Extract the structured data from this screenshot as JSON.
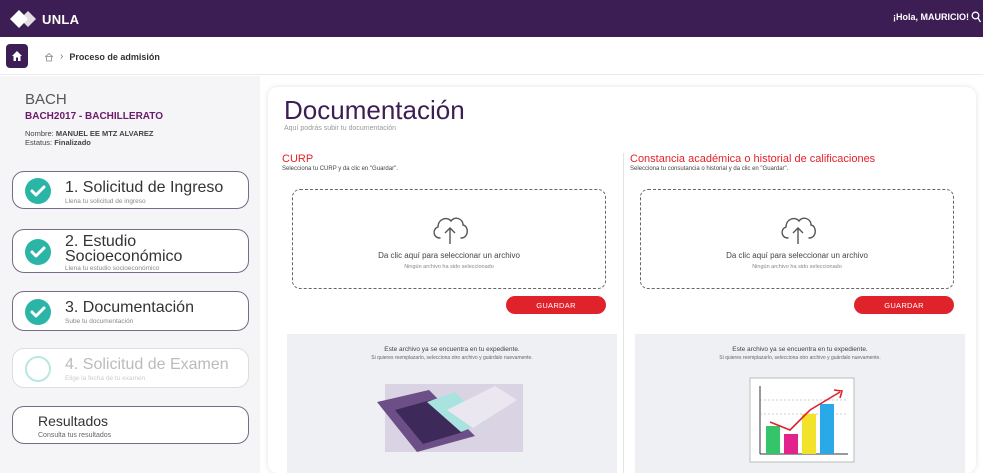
{
  "app": {
    "name": "UNLA",
    "greeting": "¡Hola, MAURICIO!"
  },
  "breadcrumb": {
    "current": "Proceso de admisión"
  },
  "program": {
    "code": "BACH",
    "name": "BACH2017 - BACHILLERATO",
    "student_label": "Nombre:",
    "student_name": "MANUEL EE MTZ ALVAREZ",
    "status_label": "Estatus:",
    "status_value": "Finalizado"
  },
  "steps": [
    {
      "title": "1. Solicitud de Ingreso",
      "sub": "Llena tu solicitud de ingreso",
      "state": "done"
    },
    {
      "title_line1": "2. Estudio",
      "title_line2": "Socioeconómico",
      "sub": "Llena tu estudio socioeconómico",
      "state": "done"
    },
    {
      "title": "3. Documentación",
      "sub": "Sube tu documentación",
      "state": "done"
    },
    {
      "title": "4. Solicitud de Examen",
      "sub": "Elige la fecha de tu examen",
      "state": "pending"
    }
  ],
  "results": {
    "title": "Resultados",
    "sub": "Consulta tus resultados"
  },
  "main": {
    "title": "Documentación",
    "subtitle": "Aquí podrás subir tu documentación",
    "documents": [
      {
        "title": "CURP",
        "instructions": "Selecciona tu CURP y da clic en \"Guardar\".",
        "dropzone_main": "Da clic aquí para seleccionar un archivo",
        "dropzone_sub": "Ningún archivo ha sido seleccionado",
        "save_label": "GUARDAR",
        "file_status": "Este archivo ya se encuentra en tu expediente.",
        "file_hint": "Si quieres reemplazarlo, selecciona otro archivo y guárdalo nuevamente."
      },
      {
        "title": "Constancia académica o historial de calificaciones",
        "instructions": "Selecciona tu consutancia o historial y da clic en \"Guardar\".",
        "dropzone_main": "Da clic aquí para seleccionar un archivo",
        "dropzone_sub": "Ningún archivo ha sido seleccionado",
        "save_label": "GUARDAR",
        "file_status": "Este archivo ya se encuentra en tu expediente.",
        "file_hint": "Si quieres reemplazarlo, selecciona otro archivo y guárdalo nuevamente."
      }
    ]
  },
  "colors": {
    "brand": "#3d1e54",
    "accent": "#e0232a",
    "success": "#2ab5a6"
  },
  "icons": [
    "unla-logo-icon",
    "search-icon",
    "home-icon",
    "house-icon",
    "chevron-right-icon",
    "check-icon",
    "cloud-upload-icon"
  ]
}
